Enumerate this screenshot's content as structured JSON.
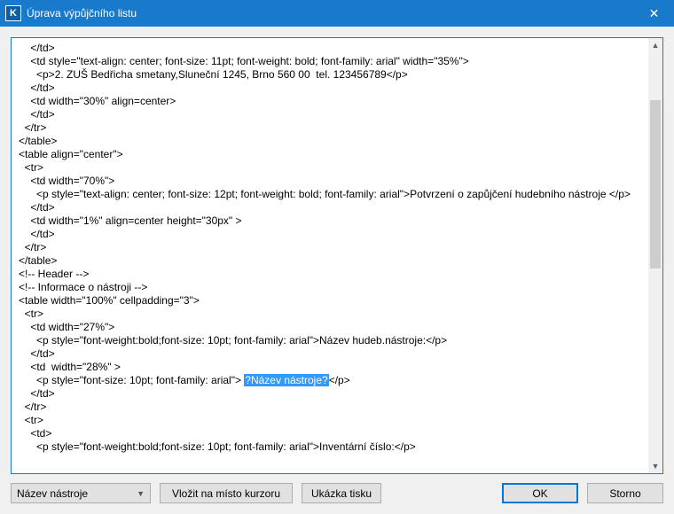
{
  "window": {
    "icon_letter": "K",
    "title": "Úprava výpůjčního listu",
    "close_label": "✕"
  },
  "code_lines": [
    "    </td>",
    "    <td style=\"text-align: center; font-size: 11pt; font-weight: bold; font-family: arial\" width=\"35%\">",
    "      <p>2. ZUŠ Bedřicha smetany,Sluneční 1245, Brno 560 00  tel. 123456789</p>",
    "    </td>",
    "    <td width=\"30%\" align=center>",
    "    </td>",
    "  </tr>",
    "</table>",
    "<table align=\"center\">",
    "  <tr>",
    "    <td width=\"70%\">",
    "      <p style=\"text-align: center; font-size: 12pt; font-weight: bold; font-family: arial\">Potvrzení o zapůjčení hudebního nástroje </p>",
    "    </td>",
    "    <td width=\"1%\" align=center height=\"30px\" >",
    "    </td>",
    "  </tr>",
    "</table>",
    "<!-- Header -->",
    "",
    "<!-- Informace o nástroji -->",
    "<table width=\"100%\" cellpadding=\"3\">",
    "  <tr>",
    "    <td width=\"27%\">",
    "      <p style=\"font-weight:bold;font-size: 10pt; font-family: arial\">Název hudeb.nástroje:</p>",
    "    </td>",
    "    <td  width=\"28%\" >",
    "      <p style=\"font-size: 10pt; font-family: arial\"> ",
    "</p>",
    "    </td>",
    "  </tr>",
    "  <tr>",
    "    <td>",
    "      <p style=\"font-weight:bold;font-size: 10pt; font-family: arial\">Inventární číslo:</p>"
  ],
  "highlight": {
    "line_index": 26,
    "text": "?Název nástroje?"
  },
  "controls": {
    "select_value": "Název nástroje",
    "btn_insert": "Vložit na místo kurzoru",
    "btn_preview": "Ukázka tisku",
    "btn_ok": "OK",
    "btn_cancel": "Storno"
  }
}
